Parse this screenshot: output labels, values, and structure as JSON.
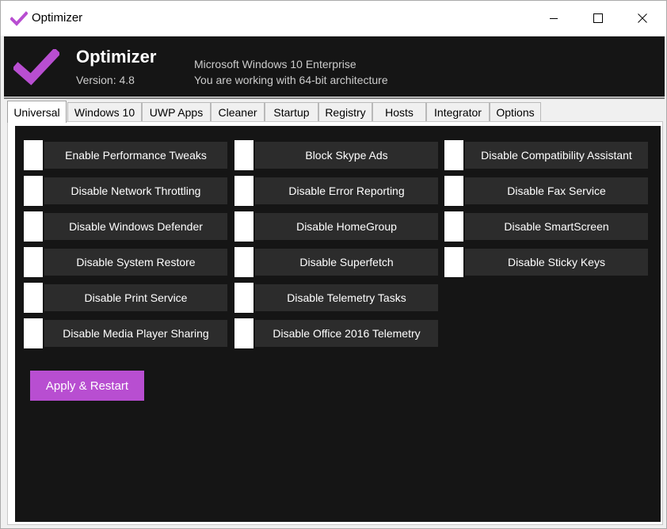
{
  "window": {
    "title": "Optimizer",
    "minimize": "minimize",
    "maximize": "maximize",
    "close": "close"
  },
  "header": {
    "app_name": "Optimizer",
    "version": "Version: 4.8",
    "os": "Microsoft Windows 10 Enterprise",
    "arch": "You are working with 64-bit architecture"
  },
  "tabs": [
    "Universal",
    "Windows 10",
    "UWP Apps",
    "Cleaner",
    "Startup",
    "Registry",
    "Hosts",
    "Integrator",
    "Options"
  ],
  "active_tab": "Universal",
  "toggles": {
    "col1": [
      "Enable Performance Tweaks",
      "Disable Network Throttling",
      "Disable Windows Defender",
      "Disable System Restore",
      "Disable Print Service",
      "Disable Media Player Sharing"
    ],
    "col2": [
      "Block Skype Ads",
      "Disable Error Reporting",
      "Disable HomeGroup",
      "Disable Superfetch",
      "Disable Telemetry Tasks",
      "Disable Office 2016 Telemetry"
    ],
    "col3": [
      "Disable Compatibility Assistant",
      "Disable Fax Service",
      "Disable SmartScreen",
      "Disable Sticky Keys"
    ]
  },
  "apply_label": "Apply & Restart",
  "colors": {
    "accent": "#b84ed1",
    "background": "#151515",
    "toggle_label_bg": "#2c2c2c",
    "text": "#ffffff"
  }
}
